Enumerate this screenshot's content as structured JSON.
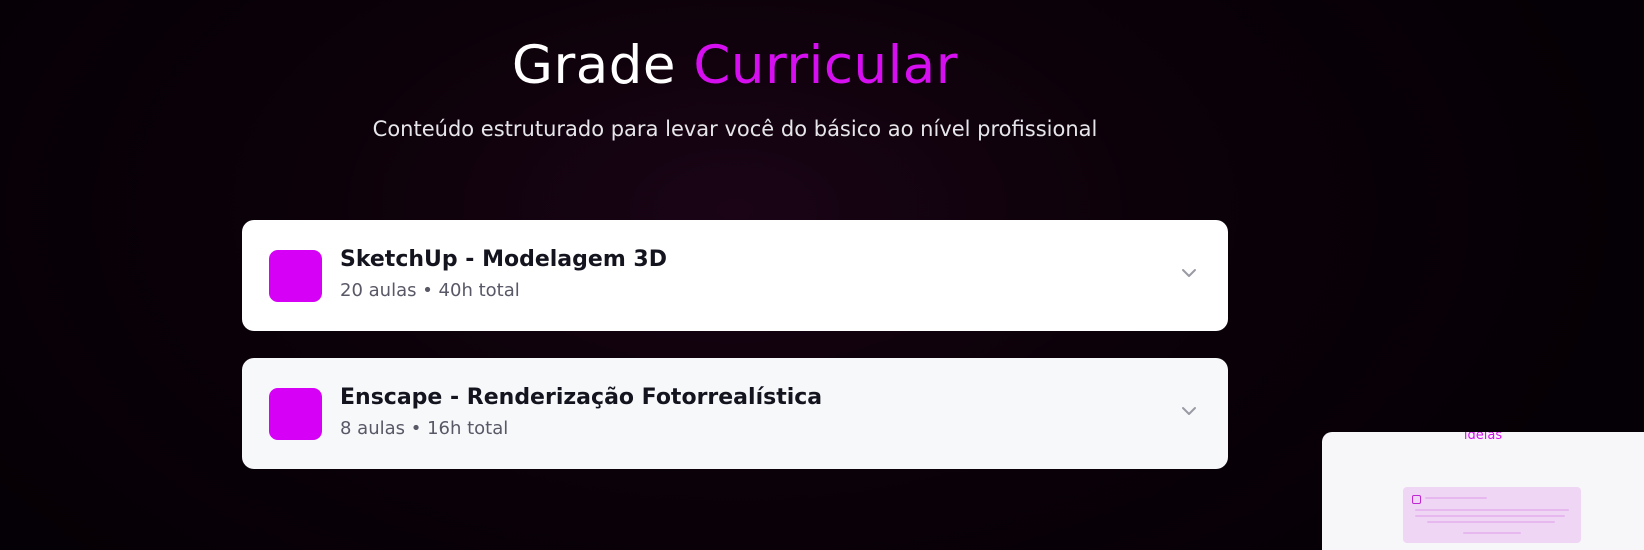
{
  "section": {
    "title_part1": "Grade",
    "title_part2": "Curricular",
    "subtitle": "Conteúdo estruturado para levar você do básico ao nível profissional"
  },
  "modules": [
    {
      "title": "SketchUp - Modelagem 3D",
      "meta": "20 aulas • 40h total",
      "icon": "chevron-down-icon",
      "badge_color": "#d500f5"
    },
    {
      "title": "Enscape - Renderização Fotorrealística",
      "meta": "8 aulas • 16h total",
      "icon": "chevron-down-icon",
      "badge_color": "#d500f5"
    }
  ],
  "preview_popup": {
    "visible_text": "ideias"
  },
  "colors": {
    "accent": "#d60ff0",
    "background": "#0c0109",
    "card": "#ffffff"
  }
}
